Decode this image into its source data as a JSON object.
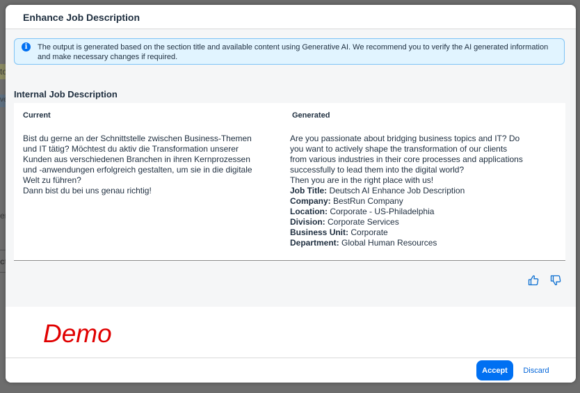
{
  "background": {
    "fragments": [
      "to",
      "ve",
      "er",
      "ct"
    ]
  },
  "dialog": {
    "title": "Enhance Job Description",
    "info": "The output is generated based on the section title and available content using Generative AI. We recommend you to verify the AI generated information and make necessary changes if required.",
    "section_title": "Internal Job Description",
    "current": {
      "header": "Current",
      "lines": [
        "Bist du gerne an der Schnittstelle zwischen Business-Themen",
        "und IT tätig? Möchtest du aktiv die Transformation unserer",
        "Kunden aus verschiedenen Branchen in ihren Kernprozessen",
        "und -anwendungen erfolgreich gestalten, um sie in die digitale",
        "Welt zu führen?",
        "Dann bist du bei uns genau richtig!"
      ]
    },
    "generated": {
      "header": "Generated",
      "lines": [
        "Are you passionate about bridging business topics and IT? Do",
        "you want to actively shape the transformation of our clients",
        "from various industries in their core processes and applications",
        "successfully to lead them into the digital world?",
        "Then you are in the right place with us!"
      ],
      "fields": [
        {
          "label": "Job Title:",
          "value": " Deutsch AI Enhance Job Description"
        },
        {
          "label": "Company:",
          "value": " BestRun Company"
        },
        {
          "label": "Location:",
          "value": " Corporate - US-Philadelphia"
        },
        {
          "label": "Division:",
          "value": " Corporate Services"
        },
        {
          "label": "Business Unit:",
          "value": " Corporate"
        },
        {
          "label": "Department:",
          "value": " Global Human Resources"
        }
      ]
    },
    "feedback": {
      "like_icon": "thumbs-up-icon",
      "dislike_icon": "thumbs-down-icon"
    },
    "watermark": "Demo",
    "footer": {
      "accept_label": "Accept",
      "discard_label": "Discard"
    }
  },
  "colors": {
    "accent": "#0070f2",
    "info_bg": "#e1f4ff",
    "watermark": "#e00000",
    "overlay": "#6d6d6d"
  }
}
